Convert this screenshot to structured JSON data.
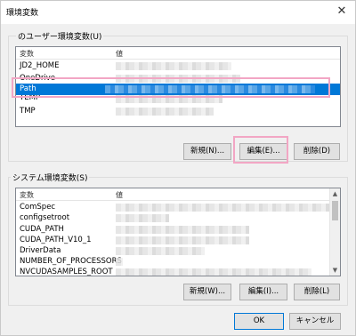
{
  "window": {
    "title": "環境変数",
    "close_glyph": "✕"
  },
  "user_section": {
    "label": "のユーザー環境変数(U)",
    "columns": [
      "変数",
      "値"
    ],
    "rows": [
      {
        "name": "JD2_HOME",
        "selected": false
      },
      {
        "name": "OneDrive",
        "selected": false
      },
      {
        "name": "Path",
        "selected": true
      },
      {
        "name": "TEMP",
        "selected": false
      },
      {
        "name": "TMP",
        "selected": false
      }
    ],
    "buttons": {
      "new": "新規(N)...",
      "edit": "編集(E)...",
      "delete": "削除(D)"
    }
  },
  "system_section": {
    "label": "システム環境変数(S)",
    "columns": [
      "変数",
      "値"
    ],
    "rows": [
      {
        "name": "ComSpec"
      },
      {
        "name": "configsetroot"
      },
      {
        "name": "CUDA_PATH"
      },
      {
        "name": "CUDA_PATH_V10_1"
      },
      {
        "name": "DriverData"
      },
      {
        "name": "NUMBER_OF_PROCESSORS"
      },
      {
        "name": "NVCUDASAMPLES_ROOT"
      }
    ],
    "buttons": {
      "new": "新規(W)...",
      "edit": "編集(I)...",
      "delete": "削除(L)"
    }
  },
  "footer": {
    "ok": "OK",
    "cancel": "キャンセル"
  },
  "colors": {
    "selection": "#0078d7",
    "highlight_box": "#f2a6c4"
  }
}
